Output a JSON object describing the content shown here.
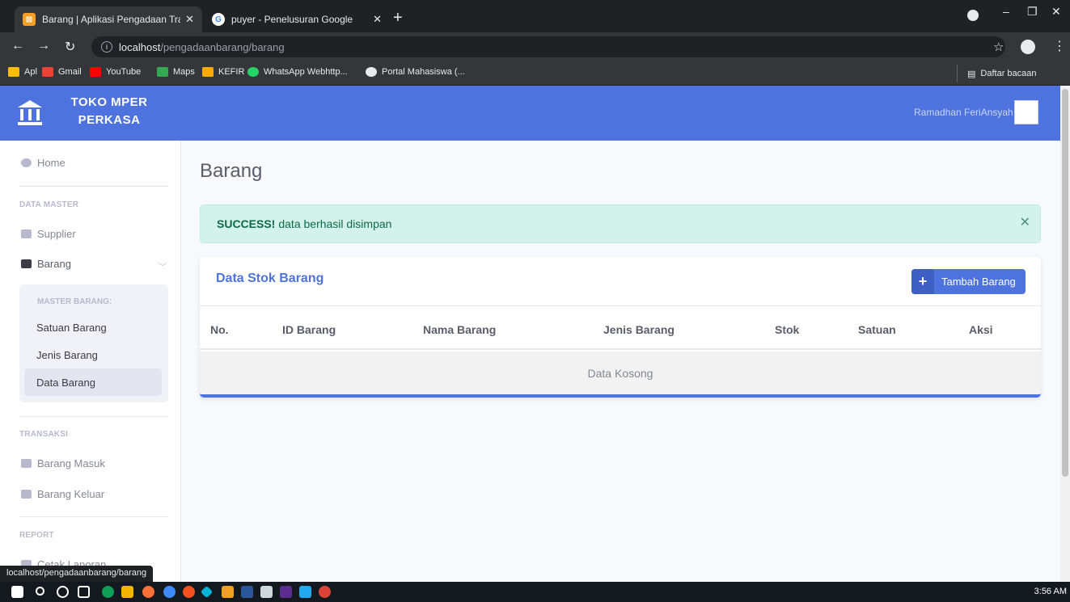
{
  "browser": {
    "tabs": [
      {
        "title": "Barang | Aplikasi Pengadaan Tran",
        "active": true,
        "favicon": "app-favicon"
      },
      {
        "title": "puyer - Penelusuran Google",
        "active": false,
        "favicon": "google-favicon"
      }
    ],
    "url_host": "localhost",
    "url_path": "/pengadaanbarang/barang",
    "bookmarks": [
      "Apl",
      "Gmail",
      "YouTube",
      "Maps",
      "KEFIR",
      "WhatsApp Webhttp...",
      "Portal Mahasiswa (..."
    ],
    "reading_list": "Daftar bacaan",
    "status_url": "localhost/pengadaanbarang/barang"
  },
  "app": {
    "brand_line1": "TOKO MPER",
    "brand_line2": "PERKASA",
    "user_name": "Ramadhan FeriAnsyah",
    "primary_color": "#4e73df"
  },
  "sidebar": {
    "home": "Home",
    "section_master": "DATA MASTER",
    "supplier": "Supplier",
    "barang": "Barang",
    "submenu_header": "MASTER BARANG:",
    "submenu": [
      "Satuan Barang",
      "Jenis Barang",
      "Data Barang"
    ],
    "section_transaksi": "TRANSAKSI",
    "barang_masuk": "Barang Masuk",
    "barang_keluar": "Barang Keluar",
    "section_report": "REPORT",
    "cetak_laporan": "Cetak Laporan"
  },
  "main": {
    "page_title": "Barang",
    "alert_strong": "SUCCESS!",
    "alert_text": "data berhasil disimpan",
    "card_title": "Data Stok Barang",
    "add_button": "Tambah Barang",
    "columns": [
      "No.",
      "ID Barang",
      "Nama Barang",
      "Jenis Barang",
      "Stok",
      "Satuan",
      "Aksi"
    ],
    "empty_text": "Data Kosong"
  },
  "taskbar": {
    "clock": "3:56 AM"
  }
}
